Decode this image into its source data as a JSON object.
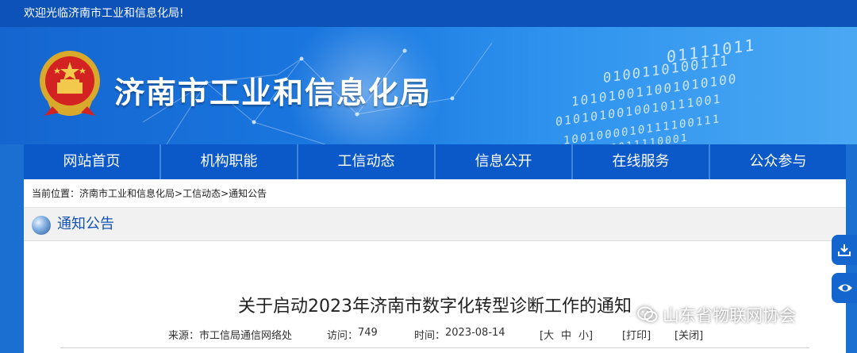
{
  "topbar": {
    "welcome": "欢迎光临济南市工业和信息化局!"
  },
  "header": {
    "site_title": "济南市工业和信息化局",
    "emblem_icon": "national-emblem-icon"
  },
  "nav": {
    "items": [
      {
        "label": "网站首页"
      },
      {
        "label": "机构职能"
      },
      {
        "label": "工信动态"
      },
      {
        "label": "信息公开"
      },
      {
        "label": "在线服务"
      },
      {
        "label": "公众参与"
      }
    ]
  },
  "breadcrumb": {
    "prefix": "当前位置：",
    "home": "济南市工业和信息化局",
    "sep": ">",
    "level1": "工信动态",
    "level2": "通知公告"
  },
  "section": {
    "title": "通知公告",
    "icon": "globe-icon"
  },
  "article": {
    "title": "关于启动2023年济南市数字化转型诊断工作的通知",
    "source_label": "来源：",
    "source": "市工信局通信网络处",
    "visits_label": "访问：",
    "visits": "749",
    "time_label": "时间：",
    "date": "2023-08-14",
    "font_size_open": "[大",
    "font_mid": "中",
    "font_small": "小]",
    "print": "[打印]",
    "close": "[关闭]"
  },
  "side_buttons": {
    "download_icon": "download-icon",
    "view_icon": "eye-icon"
  },
  "watermark": {
    "text": "山东省物联网协会",
    "icon": "wechat-icon"
  },
  "colors": {
    "primary": "#0d52b8",
    "nav": "#0b58c8",
    "section_title": "#1253b3"
  }
}
